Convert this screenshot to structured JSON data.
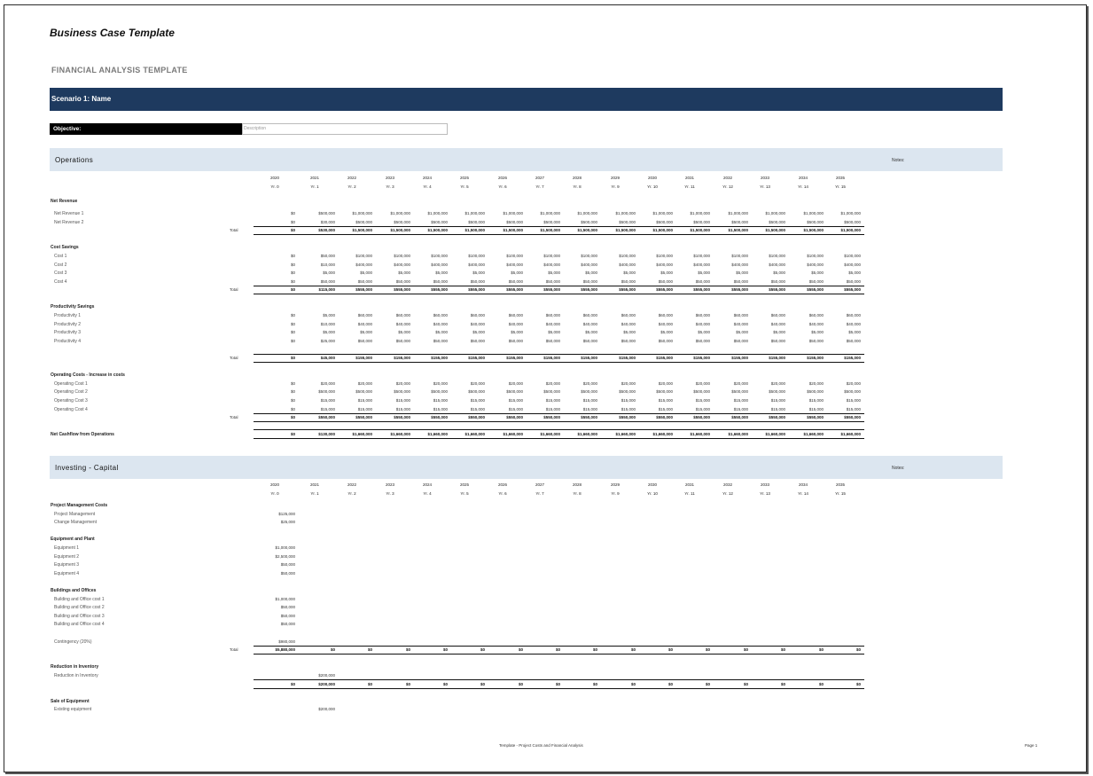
{
  "title": "Business Case Template",
  "subtitle": "FINANCIAL ANALYSIS TEMPLATE",
  "scenario": "Scenario 1: Name",
  "objective": {
    "label": "Objective:",
    "placeholder": "Description"
  },
  "years": [
    "2020",
    "2021",
    "2022",
    "2023",
    "2024",
    "2025",
    "2026",
    "2027",
    "2028",
    "2029",
    "2030",
    "2031",
    "2032",
    "2033",
    "2034",
    "2035"
  ],
  "yr_labels": [
    "Yr. 0",
    "Yr. 1",
    "Yr. 2",
    "Yr. 3",
    "Yr. 4",
    "Yr. 5",
    "Yr. 6",
    "Yr. 7",
    "Yr. 8",
    "Yr. 9",
    "Yr. 10",
    "Yr. 11",
    "Yr. 12",
    "Yr. 13",
    "Yr. 14",
    "Yr. 15"
  ],
  "total_label": "Total",
  "notes_label": "Notes:",
  "operations": {
    "title": "Operations",
    "groups": [
      {
        "label": "Net Revenue",
        "rows": [
          {
            "label": "Net Revenue 1",
            "values": [
              "$0",
              "$500,000",
              "$1,000,000",
              "$1,000,000",
              "$1,000,000",
              "$1,000,000",
              "$1,000,000",
              "$1,000,000",
              "$1,000,000",
              "$1,000,000",
              "$1,000,000",
              "$1,000,000",
              "$1,000,000",
              "$1,000,000",
              "$1,000,000",
              "$1,000,000"
            ]
          },
          {
            "label": "Net Revenue 2",
            "values": [
              "$0",
              "$30,000",
              "$500,000",
              "$500,000",
              "$500,000",
              "$500,000",
              "$500,000",
              "$500,000",
              "$500,000",
              "$500,000",
              "$500,000",
              "$500,000",
              "$500,000",
              "$500,000",
              "$500,000",
              "$500,000"
            ]
          }
        ],
        "total": [
          "$0",
          "$530,000",
          "$1,500,000",
          "$1,500,000",
          "$1,500,000",
          "$1,500,000",
          "$1,500,000",
          "$1,500,000",
          "$1,500,000",
          "$1,500,000",
          "$1,500,000",
          "$1,500,000",
          "$1,500,000",
          "$1,500,000",
          "$1,500,000",
          "$1,500,000"
        ]
      },
      {
        "label": "Cost Savings",
        "rows": [
          {
            "label": "Cost 1",
            "values": [
              "$0",
              "$50,000",
              "$100,000",
              "$100,000",
              "$100,000",
              "$100,000",
              "$100,000",
              "$100,000",
              "$100,000",
              "$100,000",
              "$100,000",
              "$100,000",
              "$100,000",
              "$100,000",
              "$100,000",
              "$100,000"
            ]
          },
          {
            "label": "Cost 2",
            "values": [
              "$0",
              "$10,000",
              "$400,000",
              "$400,000",
              "$400,000",
              "$400,000",
              "$400,000",
              "$400,000",
              "$400,000",
              "$400,000",
              "$400,000",
              "$400,000",
              "$400,000",
              "$400,000",
              "$400,000",
              "$400,000"
            ]
          },
          {
            "label": "Cost 3",
            "values": [
              "$0",
              "$5,000",
              "$5,000",
              "$5,000",
              "$5,000",
              "$5,000",
              "$5,000",
              "$5,000",
              "$5,000",
              "$5,000",
              "$5,000",
              "$5,000",
              "$5,000",
              "$5,000",
              "$5,000",
              "$5,000"
            ]
          },
          {
            "label": "Cost 4",
            "values": [
              "$0",
              "$50,000",
              "$50,000",
              "$50,000",
              "$50,000",
              "$50,000",
              "$50,000",
              "$50,000",
              "$50,000",
              "$50,000",
              "$50,000",
              "$50,000",
              "$50,000",
              "$50,000",
              "$50,000",
              "$50,000"
            ]
          }
        ],
        "total": [
          "$0",
          "$115,000",
          "$555,000",
          "$555,000",
          "$555,000",
          "$555,000",
          "$555,000",
          "$555,000",
          "$555,000",
          "$555,000",
          "$555,000",
          "$555,000",
          "$555,000",
          "$555,000",
          "$555,000",
          "$555,000"
        ]
      },
      {
        "label": "Productivity Savings",
        "rows": [
          {
            "label": "Productivity 1",
            "values": [
              "$0",
              "$5,000",
              "$60,000",
              "$60,000",
              "$60,000",
              "$60,000",
              "$60,000",
              "$60,000",
              "$60,000",
              "$60,000",
              "$60,000",
              "$60,000",
              "$60,000",
              "$60,000",
              "$60,000",
              "$60,000"
            ]
          },
          {
            "label": "Productivity 2",
            "values": [
              "$0",
              "$10,000",
              "$40,000",
              "$40,000",
              "$40,000",
              "$40,000",
              "$40,000",
              "$40,000",
              "$40,000",
              "$40,000",
              "$40,000",
              "$40,000",
              "$40,000",
              "$40,000",
              "$40,000",
              "$40,000"
            ]
          },
          {
            "label": "Productivity 3",
            "values": [
              "$0",
              "$5,000",
              "$5,000",
              "$5,000",
              "$5,000",
              "$5,000",
              "$5,000",
              "$5,000",
              "$5,000",
              "$5,000",
              "$5,000",
              "$5,000",
              "$5,000",
              "$5,000",
              "$5,000",
              "$5,000"
            ]
          },
          {
            "label": "Productivity 4",
            "values": [
              "$0",
              "$25,000",
              "$50,000",
              "$50,000",
              "$50,000",
              "$50,000",
              "$50,000",
              "$50,000",
              "$50,000",
              "$50,000",
              "$50,000",
              "$50,000",
              "$50,000",
              "$50,000",
              "$50,000",
              "$50,000"
            ]
          }
        ],
        "total": [
          "$0",
          "$45,000",
          "$155,000",
          "$155,000",
          "$155,000",
          "$155,000",
          "$155,000",
          "$155,000",
          "$155,000",
          "$155,000",
          "$155,000",
          "$155,000",
          "$155,000",
          "$155,000",
          "$155,000",
          "$155,000"
        ]
      },
      {
        "label": "Operating Costs - Increase in costs",
        "rows": [
          {
            "label": "Operating Cost 1",
            "values": [
              "$0",
              "$20,000",
              "$20,000",
              "$20,000",
              "$20,000",
              "$20,000",
              "$20,000",
              "$20,000",
              "$20,000",
              "$20,000",
              "$20,000",
              "$20,000",
              "$20,000",
              "$20,000",
              "$20,000",
              "$20,000"
            ]
          },
          {
            "label": "Operating Cost 2",
            "values": [
              "$0",
              "$500,000",
              "$500,000",
              "$500,000",
              "$500,000",
              "$500,000",
              "$500,000",
              "$500,000",
              "$500,000",
              "$500,000",
              "$500,000",
              "$500,000",
              "$500,000",
              "$500,000",
              "$500,000",
              "$500,000"
            ]
          },
          {
            "label": "Operating Cost 3",
            "values": [
              "$0",
              "$15,000",
              "$15,000",
              "$15,000",
              "$15,000",
              "$15,000",
              "$15,000",
              "$15,000",
              "$15,000",
              "$15,000",
              "$15,000",
              "$15,000",
              "$15,000",
              "$15,000",
              "$15,000",
              "$15,000"
            ]
          },
          {
            "label": "Operating Cost 4",
            "values": [
              "$0",
              "$15,000",
              "$15,000",
              "$15,000",
              "$15,000",
              "$15,000",
              "$15,000",
              "$15,000",
              "$15,000",
              "$15,000",
              "$15,000",
              "$15,000",
              "$15,000",
              "$15,000",
              "$15,000",
              "$15,000"
            ]
          }
        ],
        "total": [
          "$0",
          "$550,000",
          "$550,000",
          "$550,000",
          "$550,000",
          "$550,000",
          "$550,000",
          "$550,000",
          "$550,000",
          "$550,000",
          "$550,000",
          "$550,000",
          "$550,000",
          "$550,000",
          "$550,000",
          "$550,000"
        ]
      }
    ],
    "net": {
      "label": "Net Cashflow from Operations",
      "values": [
        "$0",
        "$130,000",
        "$1,660,000",
        "$1,660,000",
        "$1,660,000",
        "$1,660,000",
        "$1,660,000",
        "$1,660,000",
        "$1,660,000",
        "$1,660,000",
        "$1,660,000",
        "$1,660,000",
        "$1,660,000",
        "$1,660,000",
        "$1,660,000",
        "$1,660,000"
      ]
    }
  },
  "investing": {
    "title": "Investing - Capital",
    "groups": [
      {
        "label": "Project Management Costs",
        "rows": [
          {
            "label": "Project Management",
            "values": [
              "$125,000"
            ]
          },
          {
            "label": "Change Management",
            "values": [
              "$25,000"
            ]
          }
        ]
      },
      {
        "label": "Equipment and Plant",
        "rows": [
          {
            "label": "Equipment 1",
            "values": [
              "$1,000,000"
            ]
          },
          {
            "label": "Equipment 2",
            "values": [
              "$2,500,000"
            ]
          },
          {
            "label": "Equipment 3",
            "values": [
              "$50,000"
            ]
          },
          {
            "label": "Equipment 4",
            "values": [
              "$50,000"
            ]
          }
        ]
      },
      {
        "label": "Buildings and Offices",
        "rows": [
          {
            "label": "Building and Office cost 1",
            "values": [
              "$1,000,000"
            ]
          },
          {
            "label": "Building and Office cost 2",
            "values": [
              "$50,000"
            ]
          },
          {
            "label": "Building and Office cost 3",
            "values": [
              "$50,000"
            ]
          },
          {
            "label": "Building and Office cost 4",
            "values": [
              "$50,000"
            ]
          }
        ]
      }
    ],
    "contingency": {
      "label": "Contingency (20%)",
      "value": "$980,000"
    },
    "capital_total": [
      "$5,880,000",
      "$0",
      "$0",
      "$0",
      "$0",
      "$0",
      "$0",
      "$0",
      "$0",
      "$0",
      "$0",
      "$0",
      "$0",
      "$0",
      "$0",
      "$0"
    ],
    "inventory": {
      "label": "Reduction in Inventory",
      "row": {
        "label": "Reduction in Inventory",
        "value": "$200,000"
      },
      "total": [
        "$0",
        "$200,000",
        "$0",
        "$0",
        "$0",
        "$0",
        "$0",
        "$0",
        "$0",
        "$0",
        "$0",
        "$0",
        "$0",
        "$0",
        "$0",
        "$0"
      ]
    },
    "sale": {
      "label": "Sale of Equipment",
      "row": {
        "label": "Existing equipment",
        "value": "$200,000"
      }
    }
  },
  "footer": "Template - Project Costs and Financial Analysis",
  "page": "Page 1"
}
